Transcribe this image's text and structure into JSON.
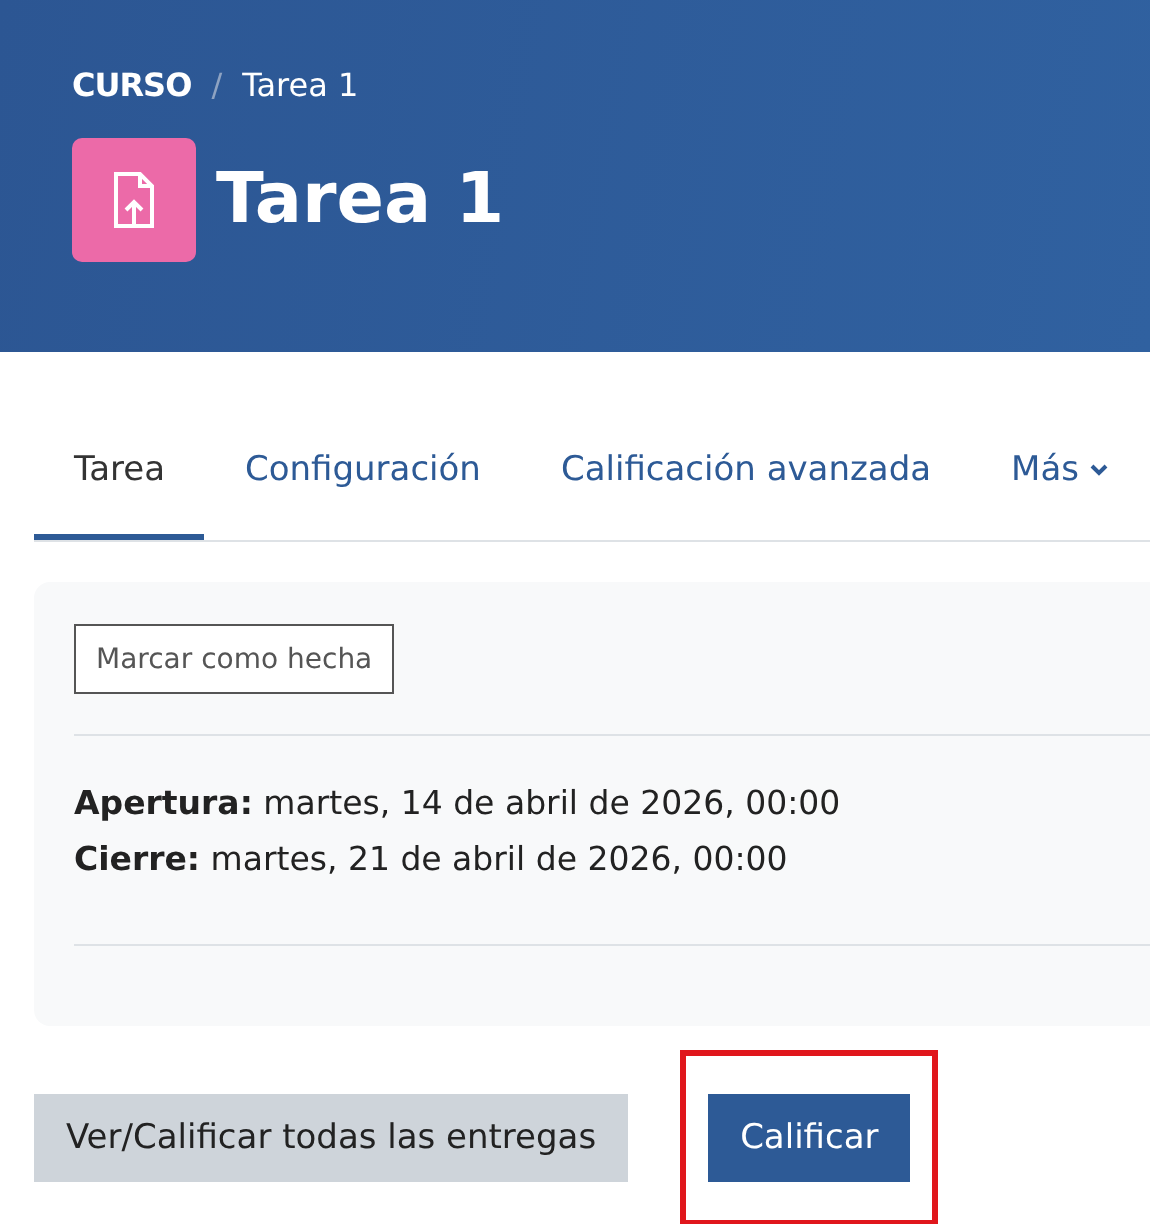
{
  "breadcrumb": [
    {
      "label": "CURSO",
      "kind": "course"
    },
    {
      "label": "Tarea 1",
      "kind": "page"
    }
  ],
  "breadcrumb_separator": "/",
  "title": "Tarea 1",
  "tabs": [
    {
      "label": "Tarea",
      "selected": true,
      "dropdown": false
    },
    {
      "label": "Configuración",
      "selected": false,
      "dropdown": false
    },
    {
      "label": "Calificación avanzada",
      "selected": false,
      "dropdown": false
    },
    {
      "label": "Más",
      "selected": false,
      "dropdown": true
    }
  ],
  "completion_button": "Marcar como hecha",
  "dates": [
    {
      "label": "Apertura:",
      "value": "martes, 14 de abril de 2026, 00:00"
    },
    {
      "label": "Cierre:",
      "value": "martes, 21 de abril de 2026, 00:00"
    }
  ],
  "actions": [
    {
      "label": "Ver/Calificar todas las entregas",
      "kind": "secondary",
      "highlighted": false
    },
    {
      "label": "Calificar",
      "kind": "primary",
      "highlighted": true
    }
  ]
}
